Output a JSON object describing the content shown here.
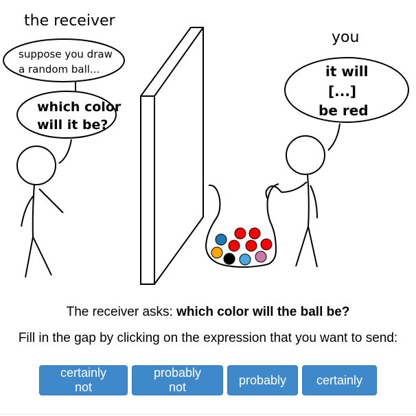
{
  "scene": {
    "receiver_label": "the receiver",
    "you_label": "you",
    "receiver_bubble_top": [
      "suppose you draw",
      "a random ball..."
    ],
    "receiver_bubble_bottom": [
      "which color",
      "will it be?"
    ],
    "you_bubble": [
      "it will",
      "[...]",
      "be red"
    ],
    "balls": [
      {
        "color": "#ff0000"
      },
      {
        "color": "#ff0000"
      },
      {
        "color": "#1f77b4"
      },
      {
        "color": "#ff0000"
      },
      {
        "color": "#ff0000"
      },
      {
        "color": "#ff0000"
      },
      {
        "color": "#ffa500"
      },
      {
        "color": "#000000"
      },
      {
        "color": "#4aa8e0"
      },
      {
        "color": "#cc79a7"
      }
    ]
  },
  "question": {
    "prefix": "The receiver asks: ",
    "emphasis": "which color will the ball be?"
  },
  "instruction": "Fill in the gap by clicking on the expression that you want to send:",
  "answers": [
    "certainly not",
    "probably not",
    "probably",
    "certainly"
  ],
  "colors": {
    "button": "#3f88c9",
    "button_text": "#ffffff"
  }
}
